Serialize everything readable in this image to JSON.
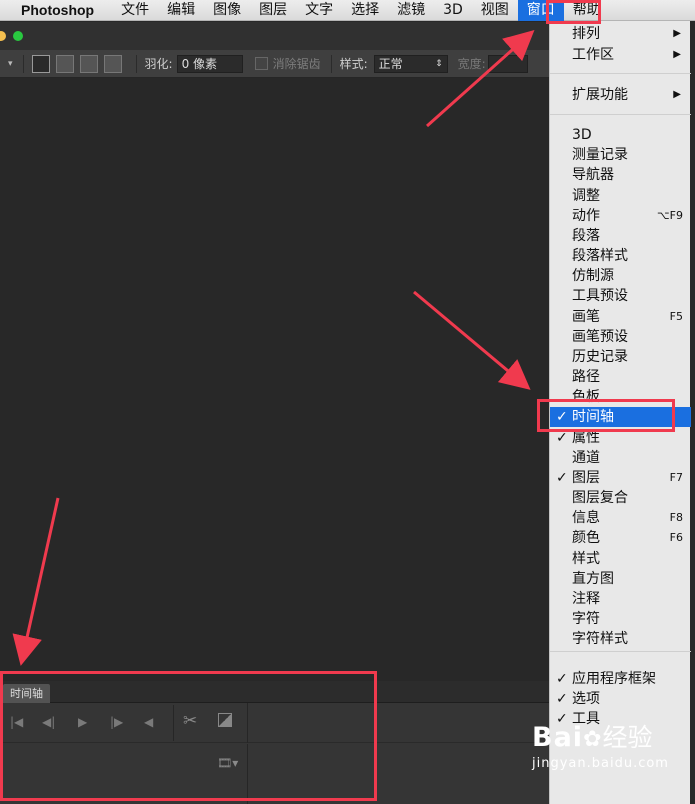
{
  "menubar": {
    "app_name": "Photoshop",
    "items": [
      "文件",
      "编辑",
      "图像",
      "图层",
      "文字",
      "选择",
      "滤镜",
      "3D",
      "视图",
      "窗口",
      "帮助"
    ],
    "active": "窗口"
  },
  "options_bar": {
    "feather_label": "羽化:",
    "feather_value": "0 像素",
    "antialias_label": "消除锯齿",
    "style_label": "样式:",
    "style_value": "正常",
    "width_label": "宽度:"
  },
  "timeline_panel": {
    "tab_label": "时间轴"
  },
  "window_menu": {
    "items": [
      {
        "label": "排列",
        "submenu": true
      },
      {
        "label": "工作区",
        "submenu": true
      },
      {
        "label": "扩展功能",
        "submenu": true
      },
      {
        "label": "3D"
      },
      {
        "label": "测量记录"
      },
      {
        "label": "导航器"
      },
      {
        "label": "调整"
      },
      {
        "label": "动作",
        "shortcut": "⌥F9"
      },
      {
        "label": "段落"
      },
      {
        "label": "段落样式"
      },
      {
        "label": "仿制源"
      },
      {
        "label": "工具预设"
      },
      {
        "label": "画笔",
        "shortcut": "F5"
      },
      {
        "label": "画笔预设"
      },
      {
        "label": "历史记录"
      },
      {
        "label": "路径"
      },
      {
        "label": "色板"
      },
      {
        "label": "时间轴",
        "checked": true,
        "highlighted": true
      },
      {
        "label": "属性",
        "checked": true
      },
      {
        "label": "通道"
      },
      {
        "label": "图层",
        "checked": true,
        "shortcut": "F7"
      },
      {
        "label": "图层复合"
      },
      {
        "label": "信息",
        "shortcut": "F8"
      },
      {
        "label": "颜色",
        "shortcut": "F6"
      },
      {
        "label": "样式"
      },
      {
        "label": "直方图"
      },
      {
        "label": "注释"
      },
      {
        "label": "字符"
      },
      {
        "label": "字符样式"
      },
      {
        "label": "应用程序框架",
        "checked": true
      },
      {
        "label": "选项",
        "checked": true
      },
      {
        "label": "工具",
        "checked": true
      }
    ]
  },
  "watermark": {
    "logo_text": "Bai",
    "logo_suffix": "经验",
    "url": "jingyan.baidu.com"
  },
  "colors": {
    "accent": "#1a6fe0",
    "annotation_red": "#f03a4e",
    "panel_dark": "#282828"
  }
}
